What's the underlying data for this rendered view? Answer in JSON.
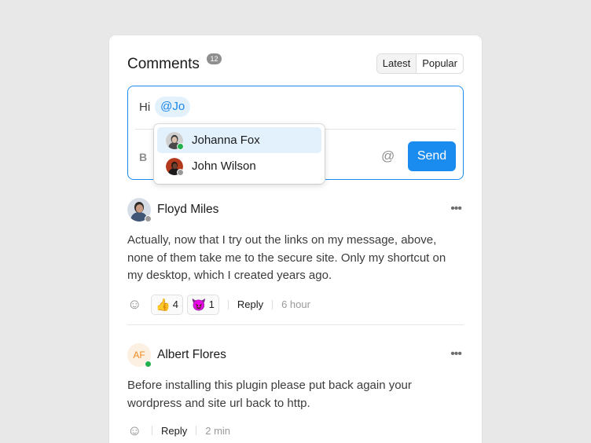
{
  "header": {
    "title": "Comments",
    "count": "12",
    "sort_options": [
      "Latest",
      "Popular"
    ],
    "active_sort": "Latest"
  },
  "composer": {
    "text": "Hi",
    "mention": "@Jo",
    "bold_label": "B",
    "at_icon": "at-icon",
    "send_label": "Send",
    "suggestions": [
      {
        "name": "Johanna Fox",
        "status": "online",
        "highlighted": true
      },
      {
        "name": "John Wilson",
        "status": "offline",
        "highlighted": false
      }
    ]
  },
  "comments": [
    {
      "author": "Floyd Miles",
      "status": "offline",
      "body": "Actually, now that I try out the links on my message, above, none of them take me to the secure site. Only my shortcut on my desktop, which I created years ago.",
      "reactions": [
        {
          "emoji": "👍",
          "icon": "thumbs-up-icon",
          "count": "4"
        },
        {
          "emoji": "😈",
          "icon": "devil-face-icon",
          "count": "1"
        }
      ],
      "reply_label": "Reply",
      "time": "6 hour"
    },
    {
      "author": "Albert Flores",
      "initials": "AF",
      "status": "online",
      "body": "Before installing this plugin please put back again your wordpress and site url back to http.",
      "reactions": [],
      "reply_label": "Reply",
      "time": "2 min"
    }
  ],
  "colors": {
    "accent": "#1a8cf0",
    "mention_bg": "#e3f1fd",
    "online": "#22b14c",
    "offline": "#9a9a9a",
    "initials_bg": "#fbf0e1",
    "initials_fg": "#f08a1c"
  }
}
